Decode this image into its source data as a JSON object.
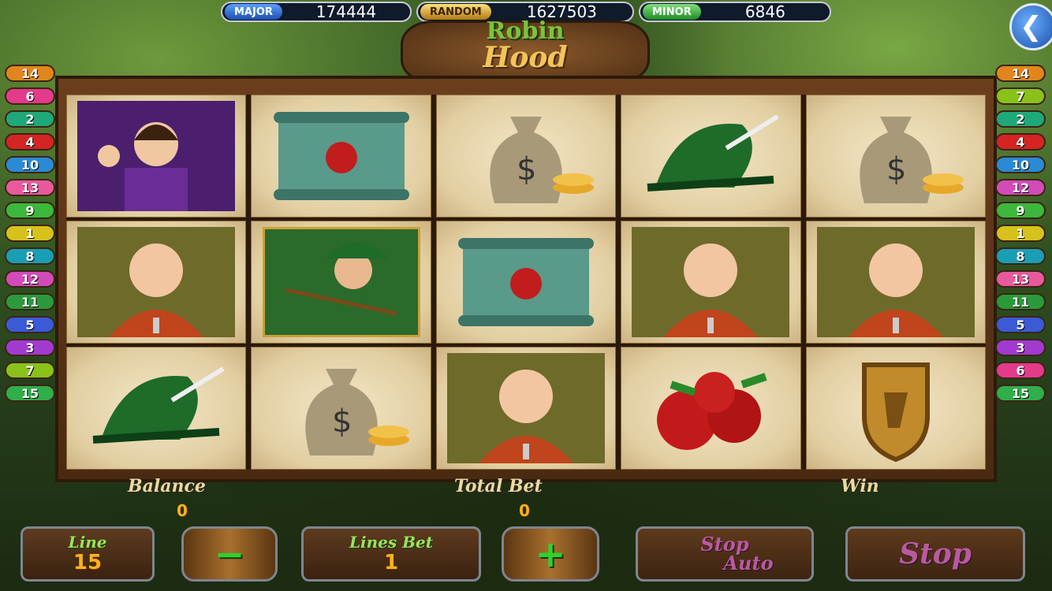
{
  "jackpots": {
    "major": {
      "label": "MAJOR",
      "value": "174444"
    },
    "random": {
      "label": "RANDOM",
      "value": "1627503"
    },
    "minor": {
      "label": "MINOR",
      "value": "6846"
    }
  },
  "logo": {
    "line1": "Robin",
    "line2": "Hood"
  },
  "back_icon": "chevron-left-icon",
  "paylines_left": [
    {
      "n": "14",
      "color": "#e0861c"
    },
    {
      "n": "6",
      "color": "#e33a8c"
    },
    {
      "n": "2",
      "color": "#1fa87a"
    },
    {
      "n": "4",
      "color": "#d42424"
    },
    {
      "n": "10",
      "color": "#2a8ad6"
    },
    {
      "n": "13",
      "color": "#e85a9c"
    },
    {
      "n": "9",
      "color": "#3cb83c"
    },
    {
      "n": "1",
      "color": "#d6c21a"
    },
    {
      "n": "8",
      "color": "#1a9eb4"
    },
    {
      "n": "12",
      "color": "#d24bb8"
    },
    {
      "n": "11",
      "color": "#2a9a3a"
    },
    {
      "n": "5",
      "color": "#3a5ad6"
    },
    {
      "n": "3",
      "color": "#a23ad0"
    },
    {
      "n": "7",
      "color": "#8ac21a"
    },
    {
      "n": "15",
      "color": "#2fae4a"
    }
  ],
  "paylines_right": [
    {
      "n": "14",
      "color": "#e0861c"
    },
    {
      "n": "7",
      "color": "#8ac21a"
    },
    {
      "n": "2",
      "color": "#1fa87a"
    },
    {
      "n": "4",
      "color": "#d42424"
    },
    {
      "n": "10",
      "color": "#2a8ad6"
    },
    {
      "n": "12",
      "color": "#d24bb8"
    },
    {
      "n": "9",
      "color": "#3cb83c"
    },
    {
      "n": "1",
      "color": "#d6c21a"
    },
    {
      "n": "8",
      "color": "#1a9eb4"
    },
    {
      "n": "13",
      "color": "#e85a9c"
    },
    {
      "n": "11",
      "color": "#2a9a3a"
    },
    {
      "n": "5",
      "color": "#3a5ad6"
    },
    {
      "n": "3",
      "color": "#a23ad0"
    },
    {
      "n": "6",
      "color": "#e33a8c"
    },
    {
      "n": "15",
      "color": "#2fae4a"
    }
  ],
  "reels": [
    [
      "sheriff",
      "friar",
      "hat"
    ],
    [
      "scroll",
      "robin",
      "moneybag"
    ],
    [
      "moneybag",
      "scroll",
      "friar"
    ],
    [
      "hat",
      "friar",
      "apples"
    ],
    [
      "moneybag",
      "friar",
      "shield"
    ]
  ],
  "info": {
    "balance_label": "Balance",
    "balance": "0",
    "totalbet_label": "Total Bet",
    "totalbet": "0",
    "win_label": "Win"
  },
  "controls": {
    "line_label": "Line",
    "line_value": "15",
    "minus": "−",
    "linesbet_label": "Lines Bet",
    "linesbet_value": "1",
    "plus": "+",
    "stop_auto_1": "Stop",
    "stop_auto_2": "Auto",
    "stop": "Stop"
  }
}
